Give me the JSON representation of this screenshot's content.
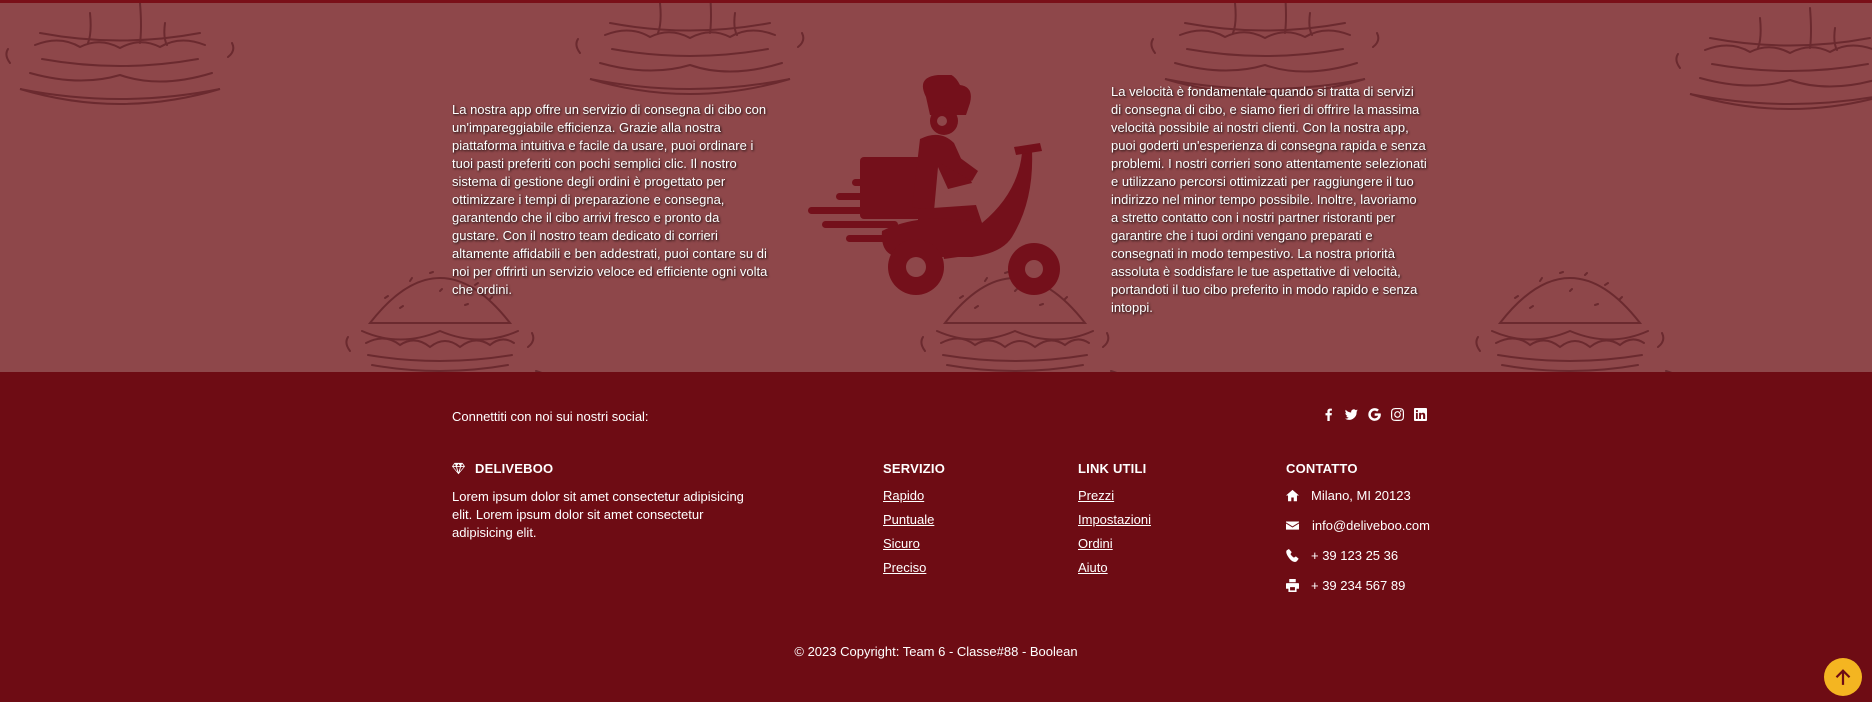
{
  "info": {
    "left_text": "La nostra app offre un servizio di consegna di cibo con un'impareggiabile efficienza. Grazie alla nostra piattaforma intuitiva e facile da usare, puoi ordinare i tuoi pasti preferiti con pochi semplici clic. Il nostro sistema di gestione degli ordini è progettato per ottimizzare i tempi di preparazione e consegna, garantendo che il cibo arrivi fresco e pronto da gustare. Con il nostro team dedicato di corrieri altamente affidabili e ben addestrati, puoi contare su di noi per offrirti un servizio veloce ed efficiente ogni volta che ordini.",
    "right_text": "La velocità è fondamentale quando si tratta di servizi di consegna di cibo, e siamo fieri di offrire la massima velocità possibile ai nostri clienti. Con la nostra app, puoi goderti un'esperienza di consegna rapida e senza problemi. I nostri corrieri sono attentamente selezionati e utilizzano percorsi ottimizzati per raggiungere il tuo indirizzo nel minor tempo possibile. Inoltre, lavoriamo a stretto contatto con i nostri partner ristoranti per garantire che i tuoi ordini vengano preparati e consegnati in modo tempestivo. La nostra priorità assoluta è soddisfare le tue aspettative di velocità, portandoti il tuo cibo preferito in modo rapido e senza intoppi.",
    "illustration": "delivery-rider-icon",
    "pattern": "burger-icon"
  },
  "footer": {
    "social_text": "Connettiti con noi sui nostri social:",
    "social_icons": [
      "facebook-icon",
      "twitter-icon",
      "google-icon",
      "instagram-icon",
      "linkedin-icon"
    ],
    "brand": {
      "icon": "gem-icon",
      "name": "DELIVEBOO",
      "description": "Lorem ipsum dolor sit amet consectetur adipisicing elit. Lorem ipsum dolor sit amet consectetur adipisicing elit."
    },
    "servizio": {
      "title": "SERVIZIO",
      "links": [
        "Rapido",
        "Puntuale",
        "Sicuro",
        "Preciso"
      ]
    },
    "link_utili": {
      "title": "LINK UTILI",
      "links": [
        "Prezzi",
        "Impostazioni",
        "Ordini",
        "Aiuto"
      ]
    },
    "contatto": {
      "title": "CONTATTO",
      "address": "Milano, MI 20123",
      "email": "info@deliveboo.com",
      "phone": "+ 39 123 25 36",
      "fax": "+ 39 234 567 89"
    },
    "copyright": "© 2023 Copyright: Team 6 - Classe#88 - Boolean"
  },
  "colors": {
    "footer_bg": "#6e0c14",
    "section_bg": "#8e474a",
    "accent": "#f4b521"
  },
  "scroll_top_icon": "arrow-up-icon"
}
